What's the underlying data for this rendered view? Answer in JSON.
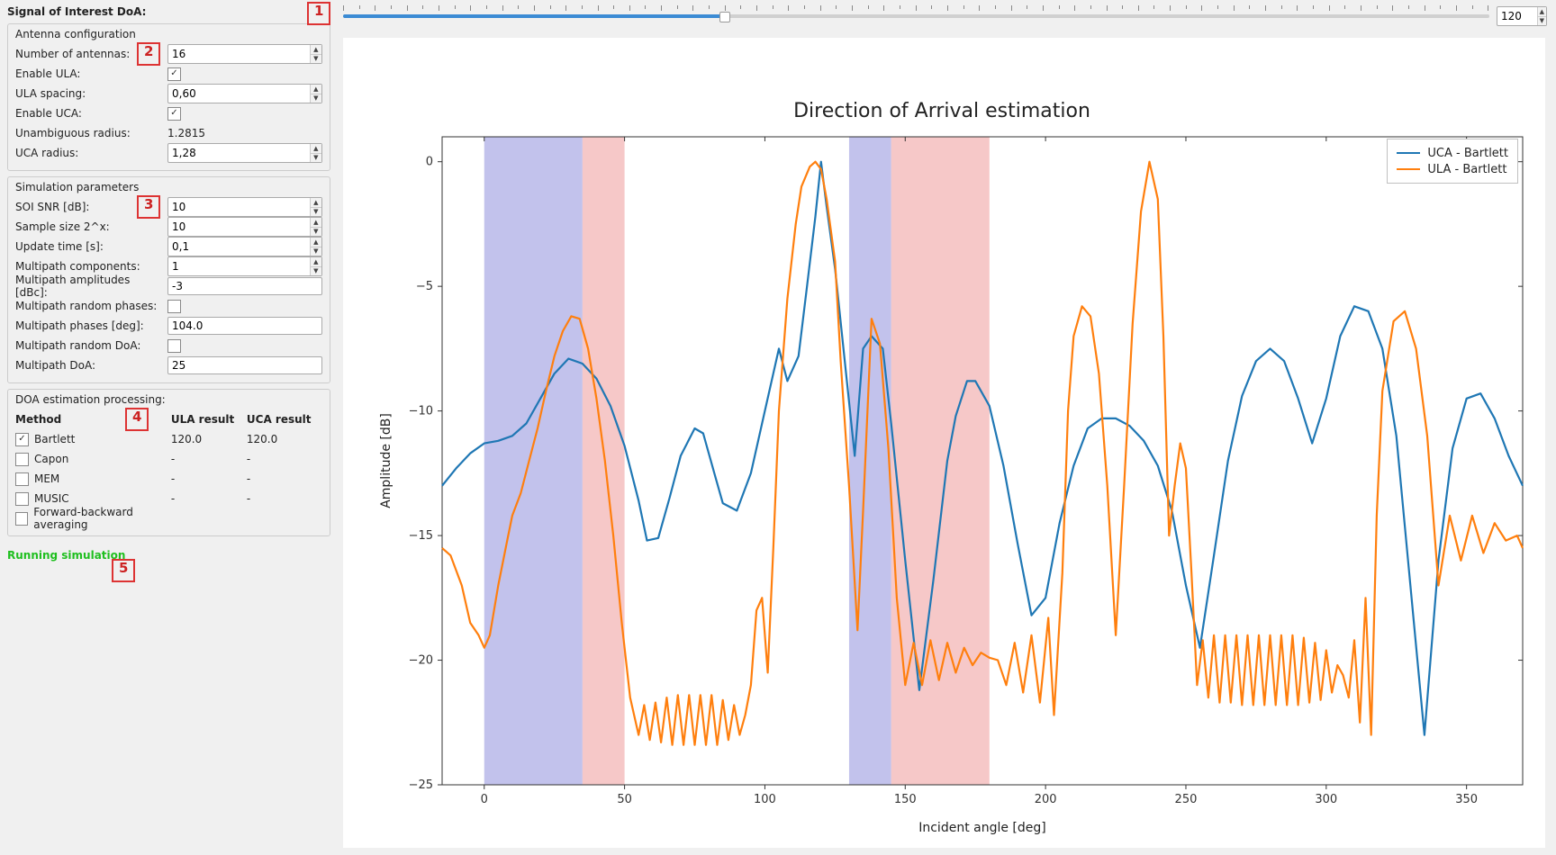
{
  "header": {
    "doa_label": "Signal of Interest DoA:"
  },
  "slider": {
    "value": 120,
    "min": 0,
    "max": 360
  },
  "markers": [
    "1",
    "2",
    "3",
    "4",
    "5"
  ],
  "antenna": {
    "group_label": "Antenna configuration",
    "num_antennas": {
      "label": "Number of antennas:",
      "value": "16"
    },
    "enable_ula": {
      "label": "Enable ULA:",
      "checked": true
    },
    "ula_spacing": {
      "label": "ULA spacing:",
      "value": "0,60"
    },
    "enable_uca": {
      "label": "Enable UCA:",
      "checked": true
    },
    "unambig_radius": {
      "label": "Unambiguous radius:",
      "value": "1.2815"
    },
    "uca_radius": {
      "label": "UCA radius:",
      "value": "1,28"
    }
  },
  "sim": {
    "group_label": "Simulation parameters",
    "soi_snr": {
      "label": "SOI SNR [dB]:",
      "value": "10"
    },
    "sample_size": {
      "label": "Sample size 2^x:",
      "value": "10"
    },
    "update_time": {
      "label": "Update time [s]:",
      "value": "0,1"
    },
    "mp_components": {
      "label": "Multipath components:",
      "value": "1"
    },
    "mp_amplitudes": {
      "label": "Multipath amplitudes [dBc]:",
      "value": "-3"
    },
    "mp_random_phases": {
      "label": "Multipath random phases:",
      "checked": false
    },
    "mp_phases": {
      "label": "Multipath phases [deg]:",
      "value": "104.0"
    },
    "mp_random_doa": {
      "label": "Multipath random DoA:",
      "checked": false
    },
    "mp_doa": {
      "label": "Multipath DoA:",
      "value": "25"
    }
  },
  "doa": {
    "group_label": "DOA estimation processing:",
    "headers": {
      "method": "Method",
      "ula": "ULA result",
      "uca": "UCA result"
    },
    "rows": [
      {
        "name": "Bartlett",
        "checked": true,
        "ula": "120.0",
        "uca": "120.0"
      },
      {
        "name": "Capon",
        "checked": false,
        "ula": "-",
        "uca": "-"
      },
      {
        "name": "MEM",
        "checked": false,
        "ula": "-",
        "uca": "-"
      },
      {
        "name": "MUSIC",
        "checked": false,
        "ula": "-",
        "uca": "-"
      }
    ],
    "fb_averaging": {
      "label": "Forward-backward averaging",
      "checked": false
    }
  },
  "status": "Running simulation",
  "chart_data": {
    "type": "line",
    "title": "Direction of Arrival estimation",
    "xlabel": "Incident angle [deg]",
    "ylabel": "Amplitude [dB]",
    "xlim": [
      -15,
      370
    ],
    "ylim": [
      -25,
      1
    ],
    "xticks": [
      0,
      50,
      100,
      150,
      200,
      250,
      300,
      350
    ],
    "yticks": [
      0,
      -5,
      -10,
      -15,
      -20,
      -25
    ],
    "bands": [
      {
        "x0": 0,
        "x1": 35,
        "color": "#8f8fdc",
        "opacity": 0.55
      },
      {
        "x0": 35,
        "x1": 50,
        "color": "#f0a3a3",
        "opacity": 0.6
      },
      {
        "x0": 130,
        "x1": 145,
        "color": "#8f8fdc",
        "opacity": 0.55
      },
      {
        "x0": 145,
        "x1": 180,
        "color": "#f0a3a3",
        "opacity": 0.6
      }
    ],
    "legend": [
      {
        "name": "UCA - Bartlett",
        "color": "#1f77b4"
      },
      {
        "name": "ULA - Bartlett",
        "color": "#ff7f0e"
      }
    ],
    "series": [
      {
        "name": "UCA - Bartlett",
        "color": "#1f77b4",
        "x": [
          -15,
          -10,
          -5,
          0,
          5,
          10,
          15,
          20,
          25,
          30,
          35,
          40,
          45,
          50,
          55,
          58,
          62,
          66,
          70,
          75,
          78,
          82,
          85,
          90,
          95,
          100,
          105,
          108,
          112,
          115,
          118,
          120,
          122,
          125,
          128,
          132,
          135,
          138,
          142,
          145,
          150,
          155,
          160,
          165,
          168,
          172,
          175,
          180,
          185,
          190,
          195,
          200,
          205,
          210,
          215,
          220,
          225,
          230,
          235,
          240,
          245,
          250,
          255,
          260,
          265,
          270,
          275,
          280,
          285,
          290,
          295,
          300,
          305,
          310,
          315,
          320,
          325,
          330,
          335,
          340,
          345,
          350,
          355,
          360,
          365,
          370
        ],
        "y": [
          -13.0,
          -12.3,
          -11.7,
          -11.3,
          -11.2,
          -11.0,
          -10.5,
          -9.5,
          -8.5,
          -7.9,
          -8.1,
          -8.7,
          -9.8,
          -11.4,
          -13.6,
          -15.2,
          -15.1,
          -13.5,
          -11.8,
          -10.7,
          -10.9,
          -12.5,
          -13.7,
          -14.0,
          -12.5,
          -10.0,
          -7.5,
          -8.8,
          -7.8,
          -5.0,
          -2.2,
          0.0,
          -1.8,
          -4.3,
          -7.5,
          -11.8,
          -7.5,
          -7.0,
          -7.5,
          -10.5,
          -16.0,
          -21.2,
          -16.8,
          -12.0,
          -10.2,
          -8.8,
          -8.8,
          -9.8,
          -12.2,
          -15.3,
          -18.2,
          -17.5,
          -14.5,
          -12.2,
          -10.7,
          -10.3,
          -10.3,
          -10.6,
          -11.2,
          -12.2,
          -14.0,
          -17.0,
          -19.5,
          -15.8,
          -12.0,
          -9.4,
          -8.0,
          -7.5,
          -8.0,
          -9.5,
          -11.3,
          -9.5,
          -7.0,
          -5.8,
          -6.0,
          -7.5,
          -11.0,
          -17.0,
          -23.0,
          -16.0,
          -11.5,
          -9.5,
          -9.3,
          -10.3,
          -11.8,
          -13.0
        ]
      },
      {
        "name": "ULA - Bartlett",
        "color": "#ff7f0e",
        "x": [
          -15,
          -12,
          -8,
          -5,
          -2,
          0,
          2,
          5,
          8,
          10,
          13,
          16,
          19,
          22,
          25,
          28,
          31,
          34,
          37,
          40,
          43,
          46,
          49,
          52,
          55,
          57,
          59,
          61,
          63,
          65,
          67,
          69,
          71,
          73,
          75,
          77,
          79,
          81,
          83,
          85,
          87,
          89,
          91,
          93,
          95,
          97,
          99,
          101,
          103,
          105,
          108,
          111,
          113,
          116,
          118,
          120,
          122,
          125,
          127,
          130,
          133,
          135,
          138,
          141,
          144,
          147,
          150,
          153,
          156,
          159,
          162,
          165,
          168,
          171,
          174,
          177,
          180,
          183,
          186,
          189,
          192,
          195,
          198,
          201,
          203,
          206,
          208,
          210,
          213,
          216,
          219,
          222,
          225,
          228,
          231,
          234,
          237,
          240,
          242,
          244,
          246,
          248,
          250,
          252,
          254,
          256,
          258,
          260,
          262,
          264,
          266,
          268,
          270,
          272,
          274,
          276,
          278,
          280,
          282,
          284,
          286,
          288,
          290,
          292,
          294,
          296,
          298,
          300,
          302,
          304,
          306,
          308,
          310,
          312,
          314,
          316,
          318,
          320,
          324,
          328,
          332,
          336,
          340,
          344,
          348,
          352,
          356,
          360,
          364,
          368,
          370
        ],
        "y": [
          -15.5,
          -15.8,
          -17.0,
          -18.5,
          -19.0,
          -19.5,
          -19.0,
          -17.0,
          -15.3,
          -14.2,
          -13.3,
          -12.0,
          -10.7,
          -9.2,
          -7.8,
          -6.8,
          -6.2,
          -6.3,
          -7.5,
          -9.5,
          -12.0,
          -15.0,
          -18.5,
          -21.5,
          -23.0,
          -21.8,
          -23.2,
          -21.7,
          -23.3,
          -21.5,
          -23.4,
          -21.4,
          -23.4,
          -21.4,
          -23.4,
          -21.4,
          -23.4,
          -21.4,
          -23.4,
          -21.6,
          -23.2,
          -21.8,
          -23.0,
          -22.2,
          -21.0,
          -18.0,
          -17.5,
          -20.5,
          -15.5,
          -10.0,
          -5.5,
          -2.5,
          -1.0,
          -0.2,
          0.0,
          -0.3,
          -1.5,
          -4.0,
          -8.0,
          -13.0,
          -18.8,
          -14.0,
          -6.3,
          -7.3,
          -11.5,
          -17.5,
          -21.0,
          -19.3,
          -21.0,
          -19.2,
          -20.8,
          -19.3,
          -20.5,
          -19.5,
          -20.2,
          -19.7,
          -19.9,
          -20.0,
          -21.0,
          -19.3,
          -21.3,
          -19.0,
          -21.7,
          -18.3,
          -22.2,
          -16.5,
          -10.0,
          -7.0,
          -5.8,
          -6.2,
          -8.5,
          -13.0,
          -19.0,
          -13.0,
          -6.5,
          -2.0,
          0.0,
          -1.5,
          -7.0,
          -15.0,
          -13.0,
          -11.3,
          -12.3,
          -16.5,
          -21.0,
          -19.2,
          -21.5,
          -19.0,
          -21.7,
          -19.0,
          -21.7,
          -19.0,
          -21.8,
          -19.0,
          -21.8,
          -19.0,
          -21.8,
          -19.0,
          -21.8,
          -19.0,
          -21.8,
          -19.0,
          -21.8,
          -19.1,
          -21.7,
          -19.3,
          -21.6,
          -19.6,
          -21.3,
          -20.2,
          -20.6,
          -21.5,
          -19.2,
          -22.5,
          -17.5,
          -23.0,
          -14.2,
          -9.2,
          -6.4,
          -6.0,
          -7.5,
          -11.0,
          -17.0,
          -14.2,
          -16.0,
          -14.2,
          -15.7,
          -14.5,
          -15.2,
          -15.0,
          -15.5
        ]
      }
    ]
  }
}
